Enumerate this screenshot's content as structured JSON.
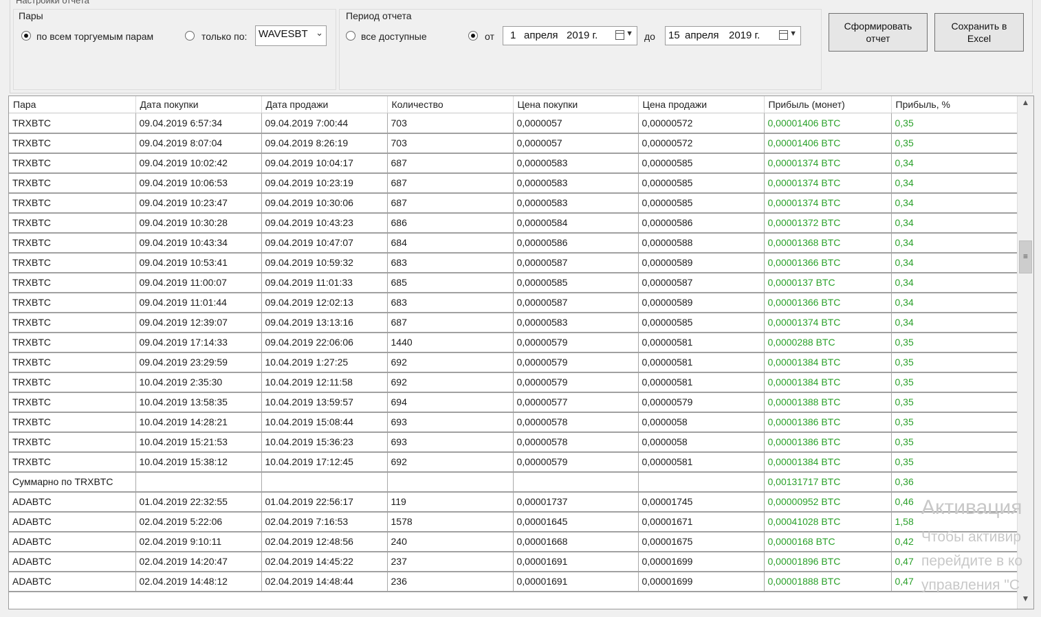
{
  "settings": {
    "group_title": "Настройки отчета",
    "pairs": {
      "title": "Пары",
      "option_all": "по всем торгуемым парам",
      "option_only": "только по:",
      "selected_pair": "WAVESBT"
    },
    "period": {
      "title": "Период отчета",
      "option_all": "все доступные",
      "from_label": "от",
      "from_day": "1",
      "from_month": "апреля",
      "from_year": "2019 г.",
      "to_label": "до",
      "to_day": "15",
      "to_month": "апреля",
      "to_year": "2019 г."
    },
    "generate_button": "Сформировать\nотчет",
    "excel_button": "Сохранить в\nExcel"
  },
  "table": {
    "columns": [
      "Пара",
      "Дата покупки",
      "Дата продажи",
      "Количество",
      "Цена покупки",
      "Цена продажи",
      "Прибыль (монет)",
      "Прибыль, %"
    ],
    "rows": [
      [
        "TRXBTC",
        "09.04.2019 6:57:34",
        "09.04.2019 7:00:44",
        "703",
        "0,0000057",
        "0,00000572",
        "0,00001406 BTC",
        "0,35"
      ],
      [
        "TRXBTC",
        "09.04.2019 8:07:04",
        "09.04.2019 8:26:19",
        "703",
        "0,0000057",
        "0,00000572",
        "0,00001406 BTC",
        "0,35"
      ],
      [
        "TRXBTC",
        "09.04.2019 10:02:42",
        "09.04.2019 10:04:17",
        "687",
        "0,00000583",
        "0,00000585",
        "0,00001374 BTC",
        "0,34"
      ],
      [
        "TRXBTC",
        "09.04.2019 10:06:53",
        "09.04.2019 10:23:19",
        "687",
        "0,00000583",
        "0,00000585",
        "0,00001374 BTC",
        "0,34"
      ],
      [
        "TRXBTC",
        "09.04.2019 10:23:47",
        "09.04.2019 10:30:06",
        "687",
        "0,00000583",
        "0,00000585",
        "0,00001374 BTC",
        "0,34"
      ],
      [
        "TRXBTC",
        "09.04.2019 10:30:28",
        "09.04.2019 10:43:23",
        "686",
        "0,00000584",
        "0,00000586",
        "0,00001372 BTC",
        "0,34"
      ],
      [
        "TRXBTC",
        "09.04.2019 10:43:34",
        "09.04.2019 10:47:07",
        "684",
        "0,00000586",
        "0,00000588",
        "0,00001368 BTC",
        "0,34"
      ],
      [
        "TRXBTC",
        "09.04.2019 10:53:41",
        "09.04.2019 10:59:32",
        "683",
        "0,00000587",
        "0,00000589",
        "0,00001366 BTC",
        "0,34"
      ],
      [
        "TRXBTC",
        "09.04.2019 11:00:07",
        "09.04.2019 11:01:33",
        "685",
        "0,00000585",
        "0,00000587",
        "0,0000137 BTC",
        "0,34"
      ],
      [
        "TRXBTC",
        "09.04.2019 11:01:44",
        "09.04.2019 12:02:13",
        "683",
        "0,00000587",
        "0,00000589",
        "0,00001366 BTC",
        "0,34"
      ],
      [
        "TRXBTC",
        "09.04.2019 12:39:07",
        "09.04.2019 13:13:16",
        "687",
        "0,00000583",
        "0,00000585",
        "0,00001374 BTC",
        "0,34"
      ],
      [
        "TRXBTC",
        "09.04.2019 17:14:33",
        "09.04.2019 22:06:06",
        "1440",
        "0,00000579",
        "0,00000581",
        "0,0000288 BTC",
        "0,35"
      ],
      [
        "TRXBTC",
        "09.04.2019 23:29:59",
        "10.04.2019 1:27:25",
        "692",
        "0,00000579",
        "0,00000581",
        "0,00001384 BTC",
        "0,35"
      ],
      [
        "TRXBTC",
        "10.04.2019 2:35:30",
        "10.04.2019 12:11:58",
        "692",
        "0,00000579",
        "0,00000581",
        "0,00001384 BTC",
        "0,35"
      ],
      [
        "TRXBTC",
        "10.04.2019 13:58:35",
        "10.04.2019 13:59:57",
        "694",
        "0,00000577",
        "0,00000579",
        "0,00001388 BTC",
        "0,35"
      ],
      [
        "TRXBTC",
        "10.04.2019 14:28:21",
        "10.04.2019 15:08:44",
        "693",
        "0,00000578",
        "0,0000058",
        "0,00001386 BTC",
        "0,35"
      ],
      [
        "TRXBTC",
        "10.04.2019 15:21:53",
        "10.04.2019 15:36:23",
        "693",
        "0,00000578",
        "0,0000058",
        "0,00001386 BTC",
        "0,35"
      ],
      [
        "TRXBTC",
        "10.04.2019 15:38:12",
        "10.04.2019 17:12:45",
        "692",
        "0,00000579",
        "0,00000581",
        "0,00001384 BTC",
        "0,35"
      ],
      [
        "Суммарно по TRXBTC",
        "",
        "",
        "",
        "",
        "",
        "0,00131717 BTC",
        "0,36"
      ],
      [
        "ADABTC",
        "01.04.2019 22:32:55",
        "01.04.2019 22:56:17",
        "119",
        "0,00001737",
        "0,00001745",
        "0,00000952 BTC",
        "0,46"
      ],
      [
        "ADABTC",
        "02.04.2019 5:22:06",
        "02.04.2019 7:16:53",
        "1578",
        "0,00001645",
        "0,00001671",
        "0,00041028 BTC",
        "1,58"
      ],
      [
        "ADABTC",
        "02.04.2019 9:10:11",
        "02.04.2019 12:48:56",
        "240",
        "0,00001668",
        "0,00001675",
        "0,0000168 BTC",
        "0,42"
      ],
      [
        "ADABTC",
        "02.04.2019 14:20:47",
        "02.04.2019 14:45:22",
        "237",
        "0,00001691",
        "0,00001699",
        "0,00001896 BTC",
        "0,47"
      ],
      [
        "ADABTC",
        "02.04.2019 14:48:12",
        "02.04.2019 14:48:44",
        "236",
        "0,00001691",
        "0,00001699",
        "0,00001888 BTC",
        "0,47"
      ]
    ]
  },
  "watermark": {
    "title": "Активация",
    "line1": "Чтобы активир",
    "line2": "перейдите в ко",
    "line3": "управления \"С"
  },
  "colors": {
    "profit": "#2aa02a"
  }
}
